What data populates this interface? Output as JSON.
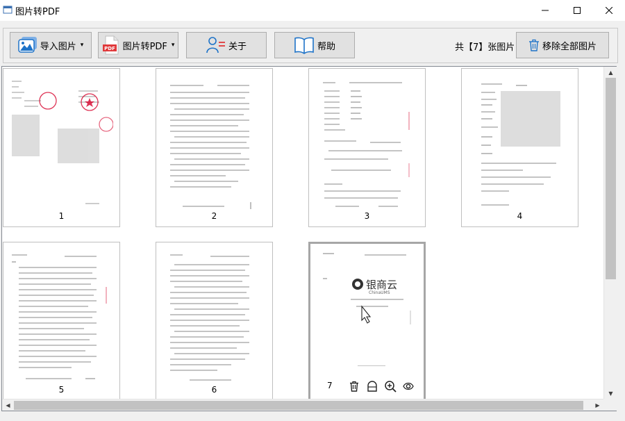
{
  "window": {
    "title": "图片转PDF",
    "min_label": "—",
    "max_label": "□",
    "close_label": "✕"
  },
  "toolbar": {
    "import_label": "导入图片",
    "convert_label": "图片转PDF",
    "about_label": "关于",
    "help_label": "帮助",
    "count_text": "共【7】张图片",
    "remove_all_label": "移除全部图片",
    "dropdown_caret": "▾"
  },
  "thumbnails": [
    {
      "number": "1"
    },
    {
      "number": "2"
    },
    {
      "number": "3"
    },
    {
      "number": "4"
    },
    {
      "number": "5"
    },
    {
      "number": "6"
    },
    {
      "number": "7",
      "selected": true,
      "logo_text": "银商云",
      "logo_sub": "ChinaUMS"
    }
  ],
  "icons": {
    "import": "image-icon",
    "convert": "pdf-file-icon",
    "about": "user-info-icon",
    "help": "book-icon",
    "remove_all": "trash-icon",
    "thumb_actions": [
      "trash-icon",
      "rotate-icon",
      "zoom-in-icon",
      "preview-eye-icon"
    ]
  },
  "colors": {
    "accent_blue": "#1e73c8",
    "pdf_red": "#e0393b",
    "stamp_red": "#d6002a",
    "scroll_thumb": "#c2c2c2"
  }
}
